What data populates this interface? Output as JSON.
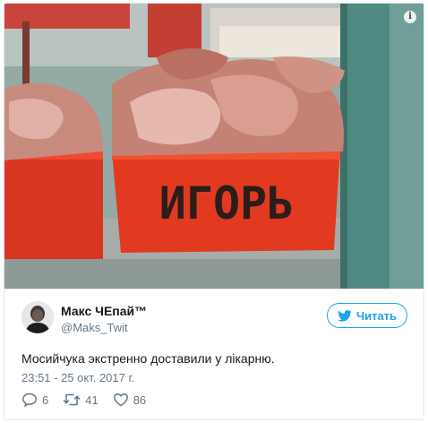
{
  "tweet": {
    "author_name": "Макс ЧЕпай™",
    "author_handle": "@Maks_Twit",
    "follow_label": "Читать",
    "text": "Мосийчука экстренно доставили у лікарню.",
    "timestamp": "23:51 - 25 окт. 2017 г.",
    "replies": "6",
    "retweets": "41",
    "likes": "86"
  },
  "photo": {
    "crate_text": "ИГОРЬ",
    "info_glyph": "i"
  },
  "colors": {
    "accent": "#1da1f2",
    "text_primary": "#14171a",
    "text_secondary": "#657786",
    "crate_red": "#e8331c",
    "border": "#e1e8ed"
  },
  "icons": [
    "info-icon",
    "twitter-bird-icon",
    "reply-icon",
    "retweet-icon",
    "like-icon"
  ]
}
